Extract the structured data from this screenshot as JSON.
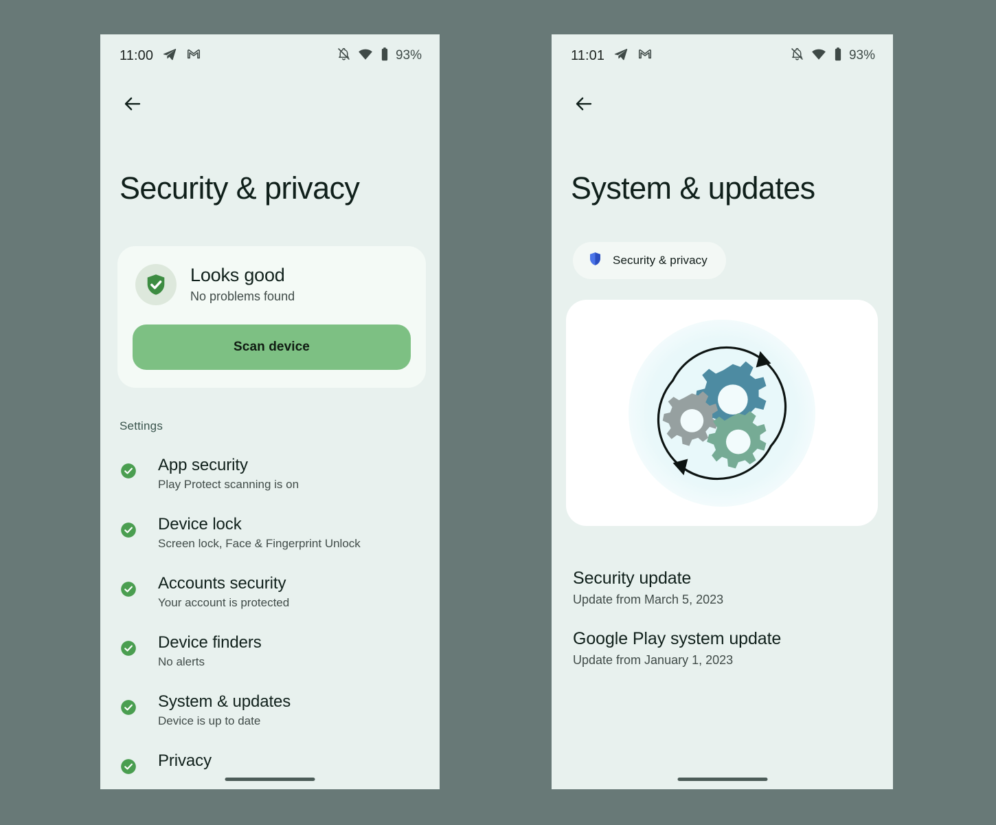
{
  "theme": {
    "page_background": "#687977",
    "screen_background": "#e8f1ee",
    "accent_green": "#7dc083",
    "check_green": "#4a9e50",
    "shield_blue": "#3b5bd6",
    "card_white": "#ffffff"
  },
  "phone_left": {
    "status_bar": {
      "time": "11:00",
      "battery_percent": "93%",
      "icons": [
        "telegram-icon",
        "gmail-icon",
        "notifications-off-icon",
        "wifi-icon",
        "battery-icon"
      ]
    },
    "back_button": "back-arrow-icon",
    "title": "Security & privacy",
    "status_card": {
      "icon": "shield-check-icon",
      "headline": "Looks good",
      "subtext": "No problems found",
      "button_label": "Scan device"
    },
    "section_label": "Settings",
    "settings": [
      {
        "title": "App security",
        "subtitle": "Play Protect scanning is on",
        "icon": "check-circle-icon"
      },
      {
        "title": "Device lock",
        "subtitle": "Screen lock, Face & Fingerprint Unlock",
        "icon": "check-circle-icon"
      },
      {
        "title": "Accounts security",
        "subtitle": "Your account is protected",
        "icon": "check-circle-icon"
      },
      {
        "title": "Device finders",
        "subtitle": "No alerts",
        "icon": "check-circle-icon"
      },
      {
        "title": "System & updates",
        "subtitle": "Device is up to date",
        "icon": "check-circle-icon"
      },
      {
        "title": "Privacy",
        "subtitle": "",
        "icon": "check-circle-icon"
      }
    ]
  },
  "phone_right": {
    "status_bar": {
      "time": "11:01",
      "battery_percent": "93%",
      "icons": [
        "telegram-icon",
        "gmail-icon",
        "notifications-off-icon",
        "wifi-icon",
        "battery-icon"
      ]
    },
    "back_button": "back-arrow-icon",
    "title": "System & updates",
    "chip": {
      "label": "Security & privacy",
      "icon": "shield-blue-icon"
    },
    "hero": {
      "illustration": "rotating-gears-icon"
    },
    "updates": [
      {
        "title": "Security update",
        "subtitle": "Update from March 5, 2023"
      },
      {
        "title": "Google Play system update",
        "subtitle": "Update from January 1, 2023"
      }
    ]
  }
}
